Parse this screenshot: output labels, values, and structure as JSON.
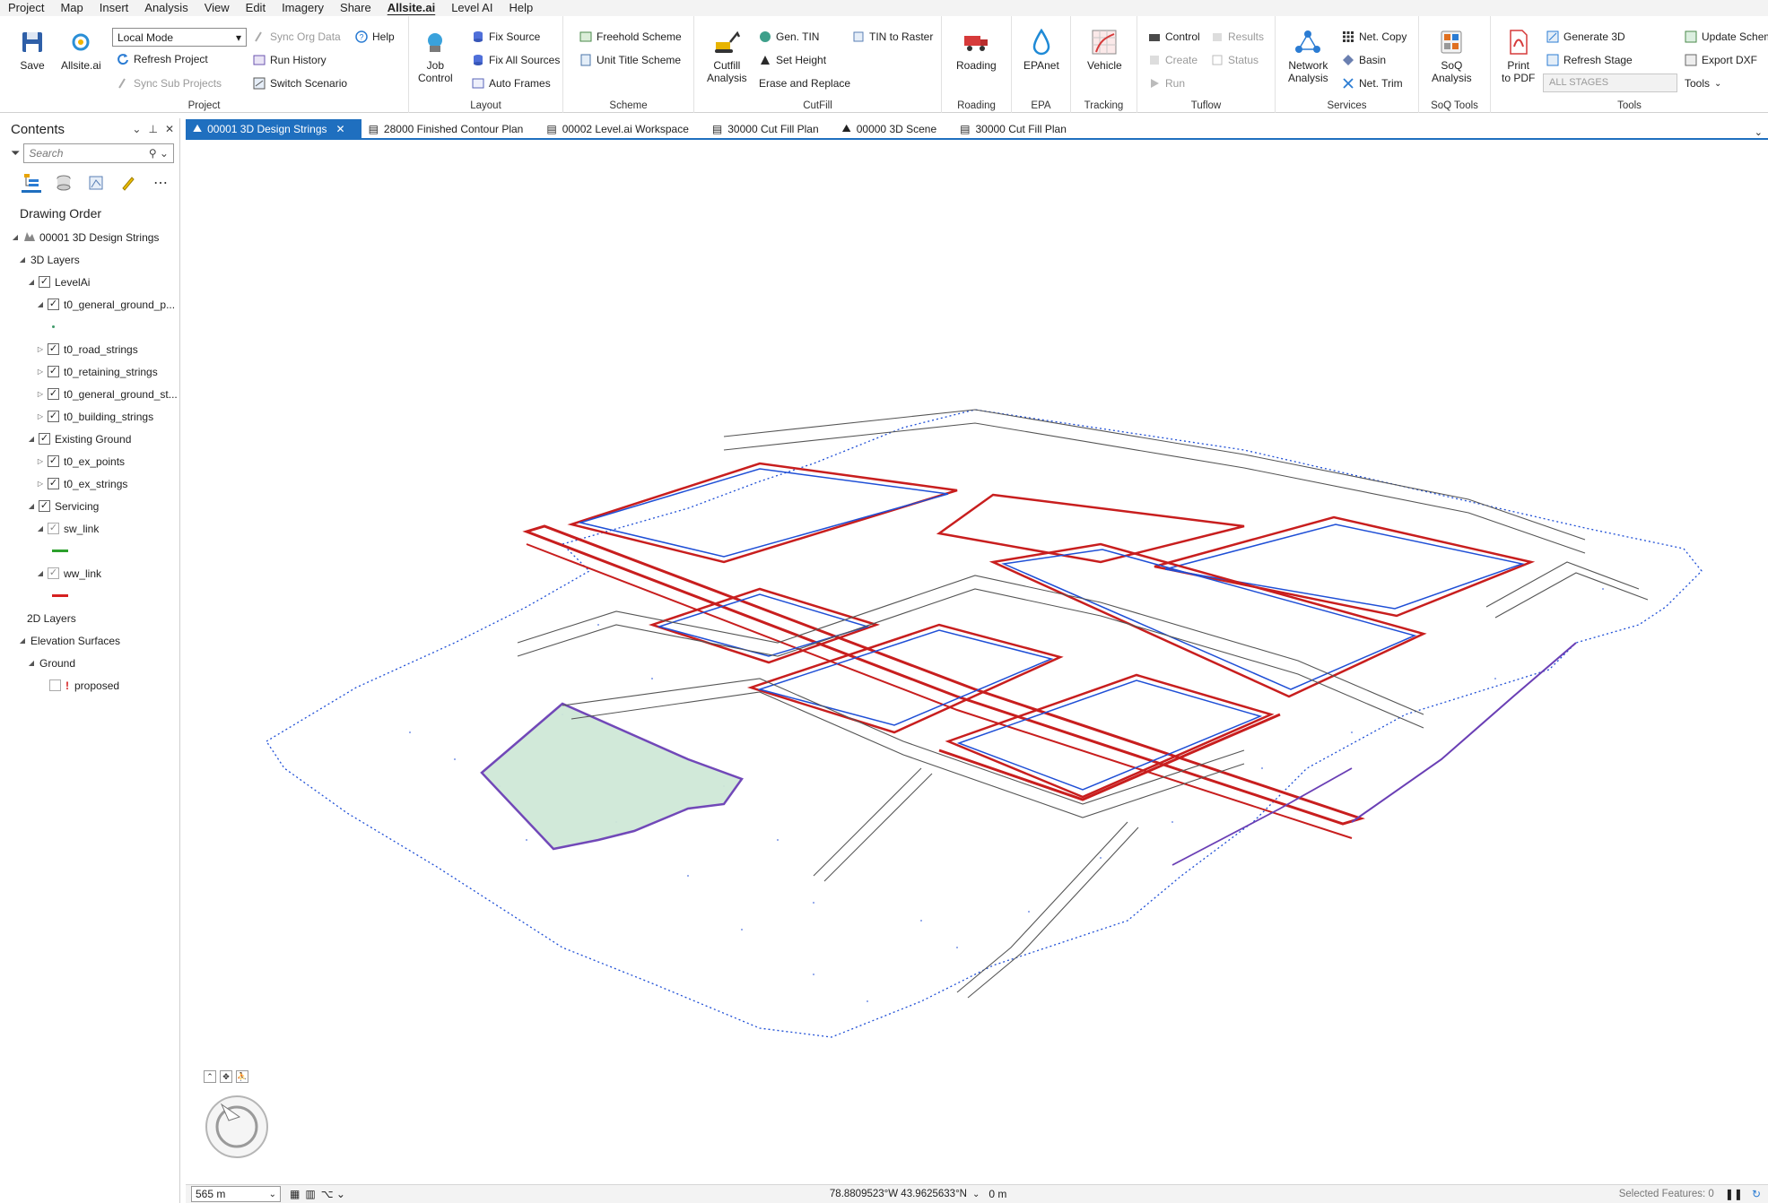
{
  "menu": [
    "Project",
    "Map",
    "Insert",
    "Analysis",
    "View",
    "Edit",
    "Imagery",
    "Share",
    "Allsite.ai",
    "Level AI",
    "Help"
  ],
  "ribbon": {
    "project": {
      "title": "Project",
      "save": "Save",
      "allsite": "Allsite.ai",
      "mode": "Local Mode",
      "refresh_project": "Refresh Project",
      "sync_sub_projects": "Sync Sub Projects",
      "sync_org_data": "Sync Org Data",
      "run_history": "Run History",
      "switch_scenario": "Switch Scenario",
      "help": "Help"
    },
    "layout": {
      "title": "Layout",
      "job": "Job",
      "control": "Control",
      "fix_source": "Fix Source",
      "fix_all_sources": "Fix All Sources",
      "auto_frames": "Auto Frames"
    },
    "scheme": {
      "title": "Scheme",
      "freehold": "Freehold Scheme",
      "unit_title": "Unit Title Scheme"
    },
    "cutfill": {
      "title": "CutFill",
      "cutfill": "Cutfill",
      "analysis": "Analysis",
      "gen_tin": "Gen. TIN",
      "set_height": "Set Height",
      "erase_replace": "Erase and Replace",
      "tin_to_raster": "TIN to Raster"
    },
    "roading": {
      "title": "Roading",
      "label": "Roading"
    },
    "epa": {
      "title": "EPA",
      "label": "EPAnet"
    },
    "tracking": {
      "title": "Tracking",
      "label": "Vehicle"
    },
    "tuflow": {
      "title": "Tuflow",
      "control": "Control",
      "create": "Create",
      "run": "Run",
      "results": "Results",
      "status": "Status"
    },
    "services": {
      "title": "Services",
      "network": "Network",
      "analysis": "Analysis",
      "net_copy": "Net. Copy",
      "basin": "Basin",
      "net_trim": "Net. Trim"
    },
    "soq": {
      "title": "SoQ Tools",
      "soq": "SoQ",
      "analysis": "Analysis"
    },
    "tools": {
      "title": "Tools",
      "print": "Print",
      "to_pdf": "to PDF",
      "generate_3d": "Generate 3D",
      "refresh_stage": "Refresh Stage",
      "all_stages": "ALL STAGES",
      "update_schema": "Update Schem",
      "export_dxf": "Export DXF",
      "tools_menu": "Tools"
    }
  },
  "contents": {
    "title": "Contents",
    "search_placeholder": "Search",
    "drawing_order": "Drawing Order",
    "map_name": "00001 3D Design Strings",
    "layers_3d": "3D Layers",
    "levelai": "LevelAi",
    "ground_points": "t0_general_ground_p...",
    "road_strings": "t0_road_strings",
    "retaining_strings": "t0_retaining_strings",
    "ground_strings": "t0_general_ground_st...",
    "building_strings": "t0_building_strings",
    "existing_ground": "Existing Ground",
    "ex_points": "t0_ex_points",
    "ex_strings": "t0_ex_strings",
    "servicing": "Servicing",
    "sw_link": "sw_link",
    "ww_link": "ww_link",
    "layers_2d": "2D Layers",
    "elevation_surfaces": "Elevation Surfaces",
    "ground": "Ground",
    "proposed": "proposed"
  },
  "tabs": [
    "00001 3D Design Strings",
    "28000 Finished Contour Plan",
    "00002 Level.ai Workspace",
    "30000 Cut Fill Plan",
    "00000 3D Scene",
    "30000 Cut Fill Plan"
  ],
  "status": {
    "scale": "565 m",
    "coordinates": "78.8809523°W 43.9625633°N",
    "elevation": "0 m",
    "selected": "Selected Features: 0"
  },
  "colors": {
    "accent": "#1f6fbf",
    "sw_link": "#2ca02c",
    "ww_link": "#d62020",
    "strings_blue": "#1f4fd6",
    "strings_red": "#c81e1e",
    "road_grey": "#555555",
    "points_green": "#3f9a6a"
  }
}
